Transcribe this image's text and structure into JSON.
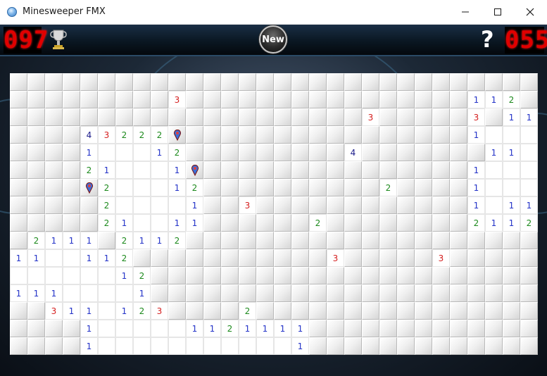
{
  "window": {
    "title": "Minesweeper FMX"
  },
  "hud": {
    "mines_remaining": "097",
    "timer": "055",
    "new_label": "New",
    "help_label": "?"
  },
  "icons": {
    "app": "app-globe-icon",
    "trophy": "trophy-icon",
    "help": "question-mark-icon",
    "flag": "map-pin-flag-icon"
  },
  "colors": {
    "one": "#2433c8",
    "two": "#1d8a1d",
    "three": "#d52020",
    "four": "#1b1b8a",
    "led": "#e00000"
  },
  "board": {
    "cols": 30,
    "rows": [
      "##########################.###",
      "#########3##################",
      "##########################3##",
      "####4322F######################",
      "####1...12#################",
      "####21...1F####################",
      "####F2...12####################",
      "#####2....1##3#################",
      "#####21..11######2#############",
      "#2111.2112######################",
      "11..112#########################",
      ".....12#########################",
      "111...1#########################",
      "##311.123####2##################",
      "####1.....1121111###############",
      "####1...........1###############"
    ]
  }
}
